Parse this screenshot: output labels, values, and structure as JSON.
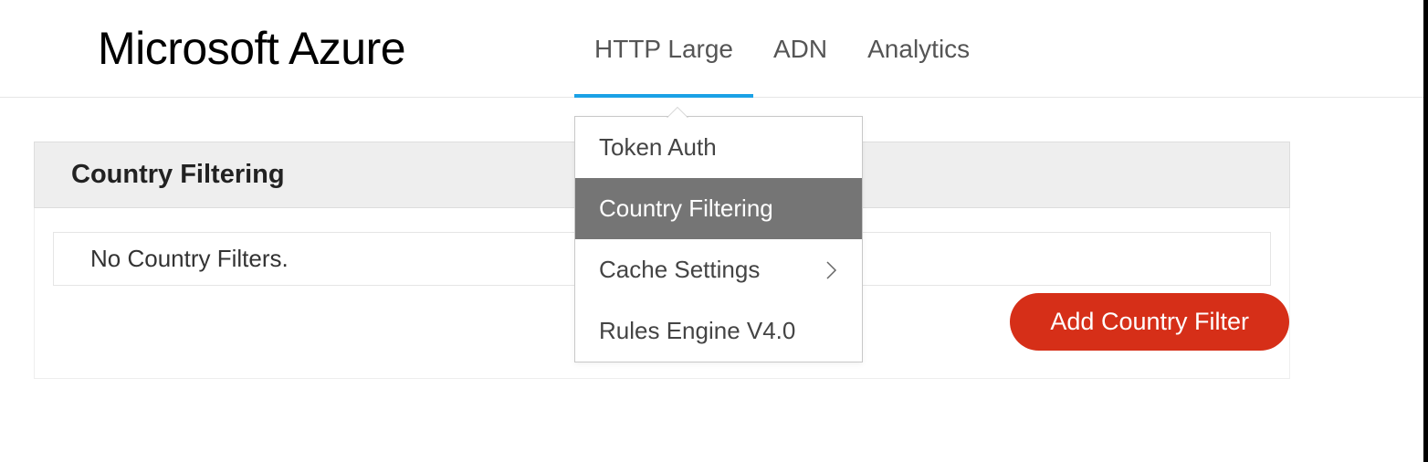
{
  "header": {
    "logo_text": "Microsoft Azure",
    "nav": [
      {
        "label": "HTTP Large",
        "active": true
      },
      {
        "label": "ADN",
        "active": false
      },
      {
        "label": "Analytics",
        "active": false
      }
    ]
  },
  "dropdown": {
    "items": [
      {
        "label": "Token Auth",
        "selected": false,
        "has_submenu": false
      },
      {
        "label": "Country Filtering",
        "selected": true,
        "has_submenu": false
      },
      {
        "label": "Cache Settings",
        "selected": false,
        "has_submenu": true
      },
      {
        "label": "Rules Engine V4.0",
        "selected": false,
        "has_submenu": false
      }
    ]
  },
  "panel": {
    "title": "Country Filtering",
    "empty_text": "No Country Filters.",
    "add_button_label": "Add Country Filter"
  }
}
